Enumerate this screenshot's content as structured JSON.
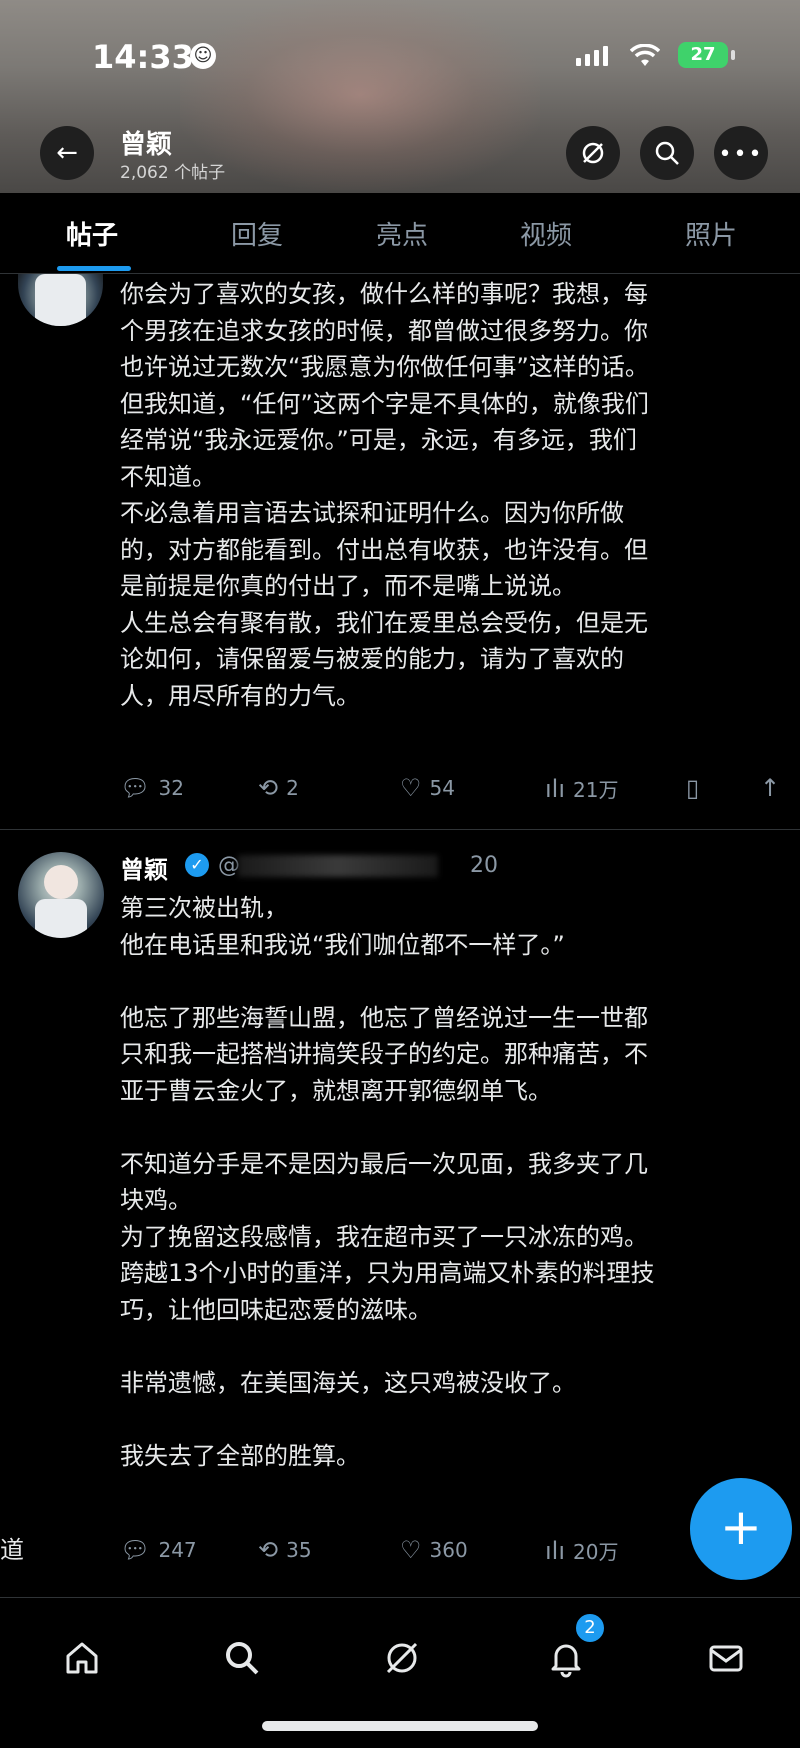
{
  "status_bar": {
    "time": "14:33",
    "battery": "27"
  },
  "header": {
    "name": "曾颖",
    "post_count": "2,062 个帖子",
    "icons": [
      "back-arrow-icon",
      "grok-icon",
      "search-icon",
      "more-icon"
    ]
  },
  "tabs": [
    {
      "label": "帖子",
      "active": true
    },
    {
      "label": "回复",
      "active": false
    },
    {
      "label": "亮点",
      "active": false
    },
    {
      "label": "视频",
      "active": false
    },
    {
      "label": "照片",
      "active": false
    }
  ],
  "posts": [
    {
      "lines": [
        "你会为了喜欢的女孩，做什么样的事呢？我想，每",
        "个男孩在追求女孩的时候，都曾做过很多努力。你",
        "也许说过无数次“我愿意为你做任何事”这样的话。",
        "但我知道，“任何”这两个字是不具体的，就像我们",
        "经常说“我永远爱你。”可是，永远，有多远，我们",
        "不知道。",
        "不必急着用言语去试探和证明什么。因为你所做",
        "的，对方都能看到。付出总有收获，也许没有。但",
        "是前提是你真的付出了，而不是嘴上说说。",
        "人生总会有聚有散，我们在爱里总会受伤，但是无",
        "论如何，请保留爱与被爱的能力，请为了喜欢的",
        "人，用尽所有的力气。"
      ],
      "stats": {
        "replies": "32",
        "reposts": "2",
        "likes": "54",
        "views": "21万"
      }
    },
    {
      "author": "曾颖",
      "handle": "@",
      "timestamp": "20",
      "lines": [
        "第三次被出轨，",
        "他在电话里和我说“我们咖位都不一样了。”",
        "",
        "他忘了那些海誓山盟，他忘了曾经说过一生一世都",
        "只和我一起搭档讲搞笑段子的约定。那种痛苦，不",
        "亚于曹云金火了，就想离开郭德纲单飞。",
        "",
        "不知道分手是不是因为最后一次见面，我多夹了几",
        "块鸡。",
        "为了挽留这段感情，我在超市买了一只冰冻的鸡。",
        "跨越13个小时的重洋，只为用高端又朴素的料理技",
        "巧，让他回味起恋爱的滋味。",
        "",
        "非常遗憾，在美国海关，这只鸡被没收了。",
        "",
        "我失去了全部的胜算。"
      ],
      "stats": {
        "replies": "247",
        "reposts": "35",
        "likes": "360",
        "views": "20万"
      }
    }
  ],
  "edge_char": "道",
  "fab": {
    "label": "+"
  },
  "bottom_nav": {
    "items": [
      "home-icon",
      "search-icon",
      "grok-icon",
      "notifications-icon",
      "messages-icon"
    ],
    "notification_count": "2"
  },
  "colors": {
    "accent": "#1d9bf0",
    "text": "#e7e9ea",
    "muted": "#8b98a5",
    "background": "#000000"
  }
}
